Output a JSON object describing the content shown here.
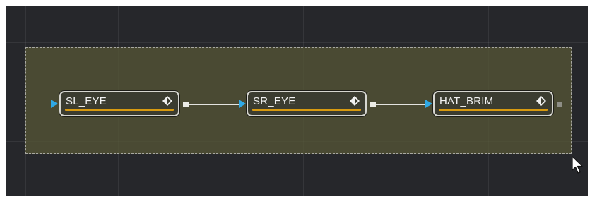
{
  "flow": {
    "nodes": [
      {
        "name": "SL_EYE",
        "icon": "mask-diamond-icon",
        "output_connected": true
      },
      {
        "name": "SR_EYE",
        "icon": "mask-diamond-icon",
        "output_connected": true
      },
      {
        "name": "HAT_BRIM",
        "icon": "mask-diamond-icon",
        "output_connected": false
      }
    ],
    "colors": {
      "canvas_bg": "#26272b",
      "selection_fill": "#545436",
      "node_accent": "#d89a10",
      "input_arrow": "#2fa9e6"
    }
  }
}
